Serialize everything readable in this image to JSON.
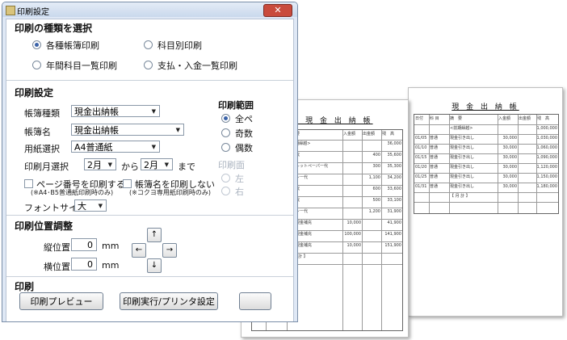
{
  "window": {
    "title": "印刷設定",
    "close_symbol": "✕"
  },
  "print_type": {
    "heading": "印刷の種類を選択",
    "options": [
      {
        "label": "各種帳簿印刷",
        "selected": true
      },
      {
        "label": "科目別印刷",
        "selected": false
      },
      {
        "label": "年間科目一覧印刷",
        "selected": false
      },
      {
        "label": "支払・入金一覧印刷",
        "selected": false
      }
    ]
  },
  "print_settings": {
    "heading": "印刷設定",
    "ledger_type_label": "帳簿種類",
    "ledger_type_value": "現金出納帳",
    "ledger_name_label": "帳簿名",
    "ledger_name_value": "現金出納帳",
    "paper_label": "用紙選択",
    "paper_value": "A4普通紙",
    "month_label": "印刷月選択",
    "month_from": "2月",
    "from_text": "から",
    "month_to": "2月",
    "to_text": "まで",
    "page_number_label": "ページ番号を印刷する",
    "page_number_note": "(※A4･B5普通紙印刷時のみ)",
    "ledger_name_print_label": "帳簿名を印刷しない",
    "ledger_name_print_note": "(※コクヨ専用紙印刷時のみ)",
    "font_size_label": "フォントサイズ",
    "font_size_value": "大"
  },
  "print_range": {
    "heading": "印刷範囲",
    "options": [
      "全ペ",
      "奇数",
      "偶数"
    ]
  },
  "print_side": {
    "heading": "印刷面",
    "options": [
      "左",
      "右"
    ]
  },
  "position_adjust": {
    "heading": "印刷位置調整",
    "vertical_label": "縦位置",
    "vertical_value": "0",
    "horizontal_label": "横位置",
    "horizontal_value": "0",
    "unit": "mm",
    "arrows": {
      "up": "↑",
      "left": "←",
      "right": "→",
      "down": "↓"
    }
  },
  "print_actions": {
    "heading": "印刷",
    "preview_label": "印刷プレビュー",
    "execute_label": "印刷実行/プリンタ設定"
  },
  "doc_front": {
    "title": "小 口 現 金 出 納 帳",
    "col_headers": [
      "日付",
      "科 目",
      "摘　要",
      "入金額",
      "出金額",
      "残　高"
    ],
    "rows": [
      [
        "",
        "",
        "<前期繰越>",
        "",
        "",
        "36,000"
      ],
      [
        "01/05",
        "旅費交通費",
        "電車代",
        "",
        "400",
        "35,600"
      ],
      [
        "01/06",
        "消耗品",
        "トイレットペーパー代",
        "",
        "300",
        "35,300"
      ],
      [
        "01/08",
        "旅費交通費",
        "タクシー代",
        "",
        "1,100",
        "34,200"
      ],
      [
        "01/09",
        "旅費交通費",
        "電車代",
        "",
        "600",
        "33,600"
      ],
      [
        "01/15",
        "通信費",
        "切手代",
        "",
        "500",
        "33,100"
      ],
      [
        "01/16",
        "旅費交通費",
        "タクシー代",
        "",
        "1,200",
        "31,900"
      ],
      [
        "01/20",
        "現金",
        "小口現金補充",
        "10,000",
        "",
        "41,900"
      ],
      [
        "01/25",
        "現金",
        "小口現金補充",
        "100,000",
        "",
        "141,900"
      ],
      [
        "01/31",
        "現金",
        "小口現金補充",
        "10,000",
        "",
        "151,900"
      ],
      [
        "",
        "",
        "【 月 計 】",
        "",
        "",
        ""
      ]
    ]
  },
  "doc_back": {
    "title": "現 金 出 納 帳",
    "col_headers": [
      "日付",
      "科 目",
      "摘　要",
      "入金額",
      "出金額",
      "残　高"
    ],
    "rows": [
      [
        "",
        "",
        "<前期繰越>",
        "",
        "",
        "1,000,000"
      ],
      [
        "01/05",
        "普通",
        "現金引き出し",
        "30,000",
        "",
        "1,030,000"
      ],
      [
        "01/10",
        "普通",
        "現金引き出し",
        "30,000",
        "",
        "1,060,000"
      ],
      [
        "01/15",
        "普通",
        "現金引き出し",
        "30,000",
        "",
        "1,090,000"
      ],
      [
        "01/20",
        "普通",
        "現金引き出し",
        "30,000",
        "",
        "1,120,000"
      ],
      [
        "01/25",
        "普通",
        "現金引き出し",
        "30,000",
        "",
        "1,150,000"
      ],
      [
        "01/31",
        "普通",
        "現金引き出し",
        "30,000",
        "",
        "1,180,000"
      ],
      [
        "",
        "",
        "【 月 計 】",
        "",
        "",
        ""
      ]
    ]
  }
}
